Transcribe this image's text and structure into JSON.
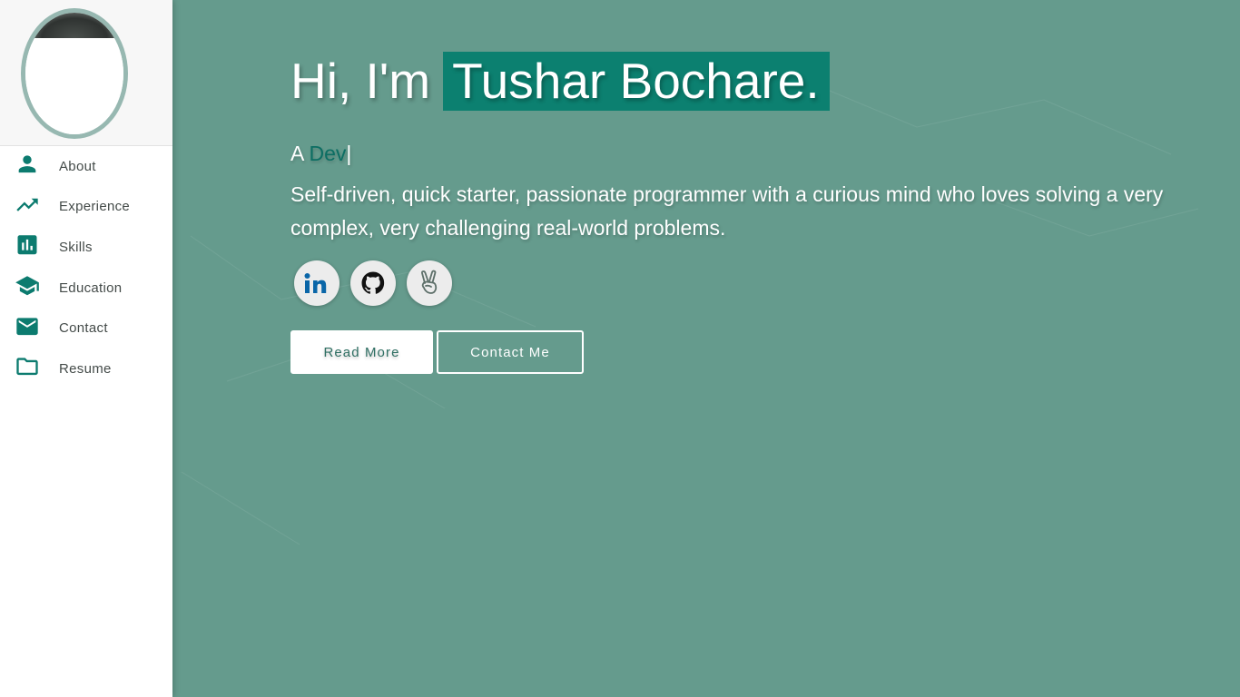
{
  "sidebar": {
    "items": [
      {
        "label": "About",
        "icon": "person-icon"
      },
      {
        "label": "Experience",
        "icon": "trending-up-icon"
      },
      {
        "label": "Skills",
        "icon": "bar-chart-icon"
      },
      {
        "label": "Education",
        "icon": "graduation-cap-icon"
      },
      {
        "label": "Contact",
        "icon": "mail-icon"
      },
      {
        "label": "Resume",
        "icon": "folder-icon"
      }
    ]
  },
  "hero": {
    "greeting": "Hi, I'm",
    "name": "Tushar Bochare.",
    "role_prefix": "A",
    "role_word": "Dev",
    "role_cursor": "|",
    "bio": "Self-driven, quick starter, passionate programmer with a curious mind who loves solving a very complex, very challenging real-world problems."
  },
  "socials": [
    {
      "name": "linkedin",
      "icon": "linkedin-icon",
      "label": "in"
    },
    {
      "name": "github",
      "icon": "github-icon"
    },
    {
      "name": "angellist",
      "icon": "peace-hand-icon"
    }
  ],
  "buttons": {
    "read_more": "Read More",
    "contact_me": "Contact Me"
  },
  "colors": {
    "accent": "#0c8070",
    "main_bg": "#659b8d",
    "icon": "#0c7b6f",
    "avatar_ring": "#97b8b1",
    "role_word": "#0c6e63"
  }
}
